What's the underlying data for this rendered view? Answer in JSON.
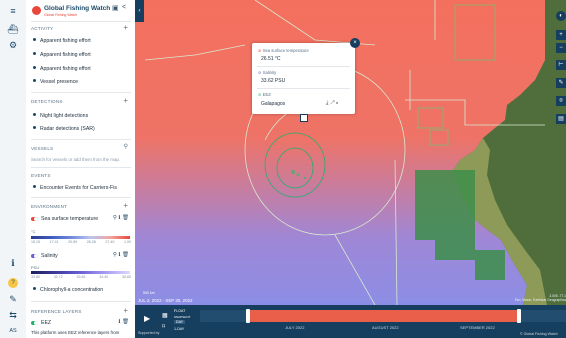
{
  "header": {
    "app_title": "Global Fishing Watch",
    "app_subtitle": "Global Fishing Watch",
    "save_icon": "bookmark-icon",
    "share_icon": "share-icon"
  },
  "rail": {
    "icons": [
      "menu-icon",
      "vessels-icon",
      "settings-icon",
      "info-icon",
      "help-icon",
      "feedback-icon",
      "language-icon"
    ],
    "help_label": "?",
    "language_label": "AS"
  },
  "activity": {
    "title": "ACTIVITY",
    "layers": [
      "Apparent fishing effort",
      "Apparent fishing effort",
      "Apparent fishing effort",
      "Vessel presence"
    ]
  },
  "detections": {
    "title": "DETECTIONS",
    "layers": [
      "Night light detections",
      "Radar detections (SAR)"
    ]
  },
  "vessels": {
    "title": "VESSELS",
    "search_placeholder": "Search for vessels or add them from the map."
  },
  "events": {
    "title": "EVENTS",
    "layers": [
      "Encounter Events for Carriers-Fis"
    ]
  },
  "environment": {
    "title": "ENVIRONMENT",
    "sst": {
      "label": "Sea surface temperature",
      "unit": "°C",
      "ticks": [
        "15.15",
        "17.41",
        "20.89",
        "26.28",
        "27.40",
        "1.00"
      ],
      "color": "#e9473b"
    },
    "salinity": {
      "label": "Salinity",
      "unit": "PSU",
      "ticks": [
        "33.80",
        "32.72",
        "33.82",
        "34.40",
        "35.60"
      ],
      "color": "#6a5fd6"
    },
    "chlorophyll": "Chlorophyll-a concentration"
  },
  "reference": {
    "title": "REFERENCE LAYERS",
    "eez_label": "EEZ",
    "eez_note": "This platform uses EEZ reference layers from",
    "eez_color": "#1fb26b"
  },
  "popup": {
    "sst_label": "Sea surface temperature",
    "sst_value": "26.51 °C",
    "salinity_label": "Salinity",
    "salinity_value": "33.62 PSU",
    "eez_label": "EEZ",
    "eez_value": "Galapagos"
  },
  "map": {
    "scale_label": "500 km",
    "attribution": "Esri, Maxar, Earthstar Geographics",
    "coordinates": "3.005 -77.1"
  },
  "timebar": {
    "range_label": "JUL 2, 2022 - SEP 30, 2022",
    "options": [
      "FLOAT",
      "SNAPSHOT",
      "DAY",
      "1-DAY"
    ],
    "months": [
      "JULY 2022",
      "AUGUST 2022",
      "SEPTEMBER 2022"
    ],
    "supported_by": "Supported by",
    "credit": "© Global Fishing Watch"
  }
}
